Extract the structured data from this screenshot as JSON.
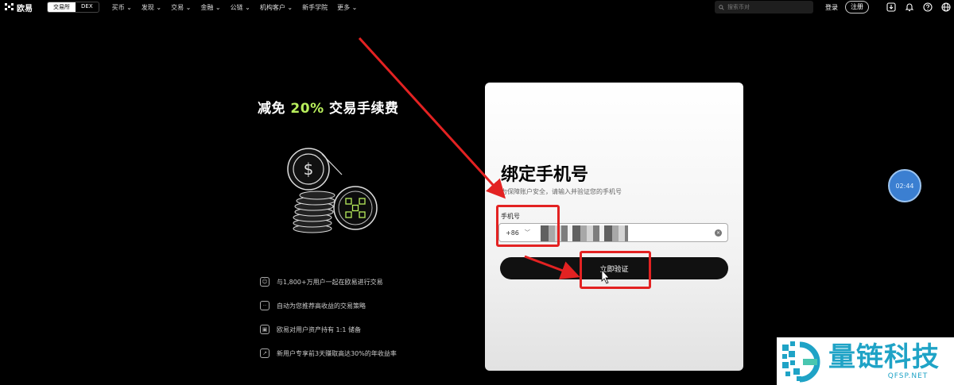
{
  "nav": {
    "brand": "欧易",
    "mode_tabs": [
      "交易所",
      "DEX"
    ],
    "menu": [
      "买币 ⌄",
      "发现 ⌄",
      "交易 ⌄",
      "金融 ⌄",
      "公链 ⌄",
      "机构客户 ⌄",
      "新手学院",
      "更多 ⌄"
    ],
    "search_placeholder": "搜索币对",
    "login": "登录",
    "register": "注册",
    "icons": [
      "download-icon",
      "bell-icon",
      "help-icon",
      "globe-icon"
    ]
  },
  "promo": {
    "headline_pre": "减免 ",
    "headline_highlight": "20%",
    "headline_post": " 交易手续费",
    "highlight_color": "#b8ee5c",
    "features": [
      "与1,800+万用户一起在欧易进行交易",
      "自动为您推荐高收益的交易策略",
      "欧易对用户资产持有 1:1 储备",
      "新用户专享前3天赚取高达30%的年收益率"
    ]
  },
  "bind_card": {
    "title": "绑定手机号",
    "subtitle": "为保障账户安全，请输入并验证您的手机号",
    "field_label": "手机号",
    "country_code": "+86",
    "verify_button": "立即验证"
  },
  "timer": "02:44",
  "watermark": {
    "name": "量链科技",
    "url": "QFSP.NET"
  },
  "colors": {
    "annotation_red": "#e32222",
    "accent_blue": "#1fa3c6"
  }
}
